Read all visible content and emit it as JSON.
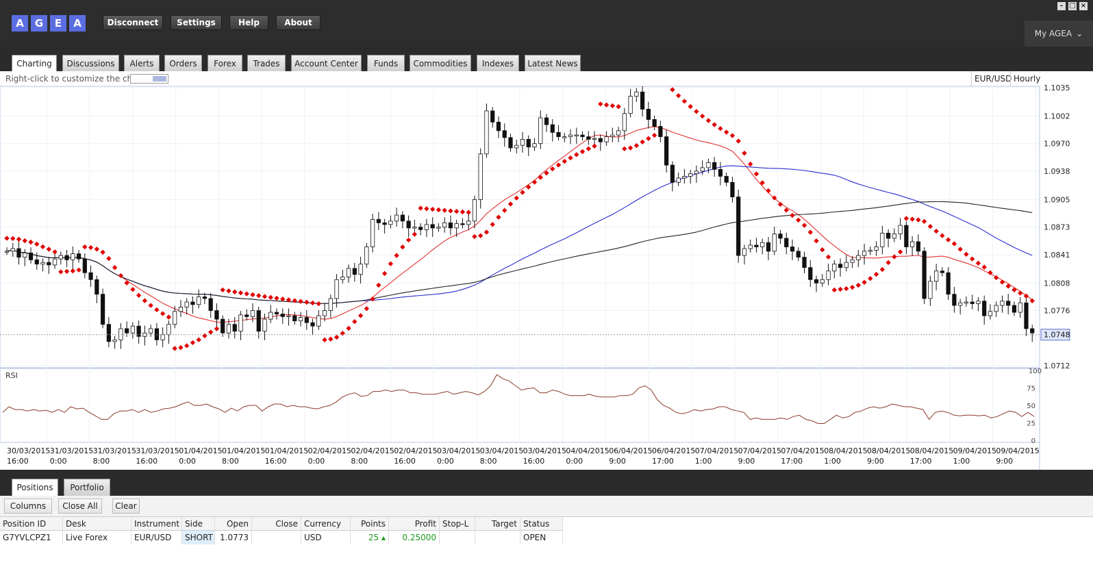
{
  "app": {
    "logo_letters": [
      "A",
      "G",
      "E",
      "A"
    ],
    "account_menu": "My AGEA"
  },
  "topbar": {
    "buttons": [
      "Disconnect",
      "Settings",
      "Help",
      "About"
    ]
  },
  "tabs": [
    "Charting",
    "Discussions",
    "Alerts",
    "Orders",
    "Forex",
    "Trades",
    "Account Center",
    "Funds",
    "Commodities",
    "Indexes",
    "Latest News"
  ],
  "chart": {
    "hint": "Right-click to customize the chart",
    "symbol": "EUR/USD",
    "interval": "Hourly",
    "price_ticks": [
      "1.1035",
      "1.1002",
      "1.0970",
      "1.0938",
      "1.0905",
      "1.0873",
      "1.0841",
      "1.0808",
      "1.0776",
      "1.0712"
    ],
    "current_price": "1.0748",
    "rsi_label": "RSI",
    "rsi_ticks": [
      "100",
      "75",
      "50",
      "25",
      "0"
    ],
    "time_labels": [
      [
        "30/03/2015",
        "16:00"
      ],
      [
        "31/03/2015",
        "0:00"
      ],
      [
        "31/03/2015",
        "8:00"
      ],
      [
        "31/03/2015",
        "16:00"
      ],
      [
        "01/04/2015",
        "0:00"
      ],
      [
        "01/04/2015",
        "8:00"
      ],
      [
        "01/04/2015",
        "16:00"
      ],
      [
        "02/04/2015",
        "0:00"
      ],
      [
        "02/04/2015",
        "8:00"
      ],
      [
        "02/04/2015",
        "16:00"
      ],
      [
        "03/04/2015",
        "0:00"
      ],
      [
        "03/04/2015",
        "8:00"
      ],
      [
        "03/04/2015",
        "16:00"
      ],
      [
        "04/04/2015",
        "0:00"
      ],
      [
        "06/04/2015",
        "9:00"
      ],
      [
        "06/04/2015",
        "17:00"
      ],
      [
        "07/04/2015",
        "1:00"
      ],
      [
        "07/04/2015",
        "9:00"
      ],
      [
        "07/04/2015",
        "17:00"
      ],
      [
        "08/04/2015",
        "1:00"
      ],
      [
        "08/04/2015",
        "9:00"
      ],
      [
        "08/04/2015",
        "17:00"
      ],
      [
        "09/04/2015",
        "1:00"
      ],
      [
        "09/04/2015",
        "9:00"
      ]
    ],
    "colors": {
      "sar": "#e00000",
      "ma_red": "#e03030",
      "ma_blue": "#2b2bd0",
      "ma_black": "#222222",
      "rsi": "#8b3a2a"
    }
  },
  "chart_data": {
    "type": "candlestick",
    "ylim": [
      1.0712,
      1.1035
    ],
    "close": [
      1.0845,
      1.0848,
      1.0838,
      1.0843,
      1.0835,
      1.083,
      1.0832,
      1.0829,
      1.0836,
      1.084,
      1.0835,
      1.0842,
      1.0836,
      1.082,
      1.0812,
      1.0795,
      1.076,
      1.074,
      1.0742,
      1.0755,
      1.075,
      1.0758,
      1.0746,
      1.075,
      1.0755,
      1.0742,
      1.0748,
      1.076,
      1.0775,
      1.078,
      1.0786,
      1.0783,
      1.0792,
      1.079,
      1.0776,
      1.0766,
      1.075,
      1.076,
      1.0752,
      1.0771,
      1.0769,
      1.0776,
      1.0752,
      1.0766,
      1.0774,
      1.0772,
      1.0769,
      1.077,
      1.0764,
      1.0768,
      1.0762,
      1.0758,
      1.077,
      1.0776,
      1.079,
      1.0812,
      1.0815,
      1.0825,
      1.0818,
      1.083,
      1.085,
      1.0882,
      1.0878,
      1.0876,
      1.088,
      1.0887,
      1.088,
      1.0872,
      1.0873,
      1.087,
      1.0876,
      1.0872,
      1.0873,
      1.0878,
      1.0872,
      1.0877,
      1.0876,
      1.088,
      1.0905,
      1.0958,
      1.1008,
      1.0995,
      1.0985,
      1.0977,
      1.0965,
      1.0968,
      1.0975,
      1.0966,
      1.097,
      1.1,
      1.0992,
      1.0983,
      1.0978,
      1.0978,
      1.098,
      1.098,
      1.0978,
      1.0975,
      1.0976,
      1.0972,
      1.0978,
      1.098,
      1.0985,
      1.1005,
      1.1025,
      1.103,
      1.101,
      1.0998,
      1.099,
      1.0978,
      1.0945,
      1.0925,
      1.093,
      1.0932,
      1.0935,
      1.0938,
      1.0942,
      1.0948,
      1.094,
      1.0932,
      1.0925,
      1.0908,
      1.084,
      1.0848,
      1.0852,
      1.085,
      1.0855,
      1.0845,
      1.0865,
      1.086,
      1.085,
      1.0845,
      1.0838,
      1.0826,
      1.0812,
      1.0808,
      1.0812,
      1.0822,
      1.083,
      1.0826,
      1.0832,
      1.0835,
      1.084,
      1.0845,
      1.0846,
      1.085,
      1.0866,
      1.086,
      1.0865,
      1.0875,
      1.085,
      1.0856,
      1.0845,
      1.079,
      1.081,
      1.0822,
      1.082,
      1.0795,
      1.0782,
      1.0785,
      1.0786,
      1.0784,
      1.0787,
      1.077,
      1.0775,
      1.0782,
      1.0787,
      1.0782,
      1.0774,
      1.0785,
      1.0755,
      1.075
    ],
    "rsi": [
      40,
      48,
      44,
      44,
      42,
      44,
      42,
      43,
      40,
      44,
      40,
      48,
      45,
      46,
      40,
      35,
      30,
      30,
      38,
      42,
      42,
      44,
      40,
      44,
      40,
      42,
      45,
      46,
      48,
      52,
      55,
      50,
      50,
      52,
      48,
      45,
      40,
      46,
      42,
      48,
      50,
      50,
      42,
      48,
      52,
      52,
      48,
      50,
      48,
      48,
      46,
      45,
      48,
      50,
      55,
      62,
      66,
      68,
      63,
      64,
      70,
      70,
      72,
      70,
      72,
      72,
      68,
      68,
      66,
      66,
      66,
      68,
      70,
      66,
      68,
      70,
      68,
      65,
      70,
      78,
      94,
      88,
      85,
      78,
      72,
      74,
      75,
      68,
      68,
      72,
      70,
      66,
      64,
      64,
      64,
      66,
      63,
      62,
      62,
      62,
      64,
      64,
      66,
      75,
      78,
      72,
      58,
      50,
      46,
      40,
      38,
      40,
      44,
      42,
      44,
      45,
      48,
      48,
      44,
      42,
      40,
      30,
      32,
      30,
      30,
      30,
      32,
      30,
      34,
      36,
      30,
      28,
      24,
      24,
      30,
      36,
      32,
      34,
      40,
      42,
      46,
      48,
      46,
      48,
      52,
      50,
      48,
      48,
      46,
      44,
      30,
      40,
      42,
      40,
      36,
      35,
      36,
      36,
      35,
      36,
      32,
      34,
      38,
      42,
      40,
      34,
      40,
      34
    ]
  },
  "bottom": {
    "tabs": [
      "Positions",
      "Portfolio"
    ],
    "toolbar": [
      "Columns",
      "Close All",
      "Clear"
    ],
    "columns": [
      "Position ID",
      "Desk",
      "Instrument",
      "Side",
      "Open",
      "Close",
      "Currency",
      "Points",
      "Profit",
      "Stop-L",
      "Target",
      "Status"
    ],
    "rows": [
      {
        "position_id": "G7YVLCPZ1",
        "desk": "Live Forex",
        "instrument": "EUR/USD",
        "side": "SHORT",
        "open": "1.0773",
        "close": "",
        "currency": "USD",
        "points": "25",
        "profit": "0.25000",
        "stop": "",
        "target": "",
        "status": "OPEN"
      }
    ],
    "colors": {
      "positive": "#1a9a1a",
      "short_bg": "#dfeefa"
    }
  }
}
